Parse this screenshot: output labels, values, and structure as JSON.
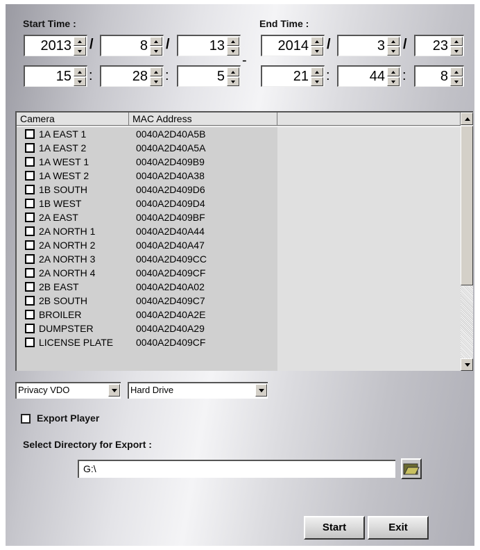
{
  "start_time": {
    "label": "Start Time :",
    "year": "2013",
    "month": "8",
    "day": "13",
    "hour": "15",
    "minute": "28",
    "second": "5"
  },
  "end_time": {
    "label": "End Time :",
    "year": "2014",
    "month": "3",
    "day": "23",
    "hour": "21",
    "minute": "44",
    "second": "8"
  },
  "separators": {
    "date": "/",
    "time": ":",
    "range": "-"
  },
  "camera_list": {
    "columns": [
      "Camera",
      "MAC Address"
    ],
    "rows": [
      {
        "camera": "1A EAST 1",
        "mac": "0040A2D40A5B"
      },
      {
        "camera": "1A EAST 2",
        "mac": "0040A2D40A5A"
      },
      {
        "camera": "1A WEST 1",
        "mac": "0040A2D409B9"
      },
      {
        "camera": "1A WEST 2",
        "mac": "0040A2D40A38"
      },
      {
        "camera": "1B SOUTH",
        "mac": "0040A2D409D6"
      },
      {
        "camera": "1B WEST",
        "mac": "0040A2D409D4"
      },
      {
        "camera": "2A EAST",
        "mac": "0040A2D409BF"
      },
      {
        "camera": "2A NORTH 1",
        "mac": "0040A2D40A44"
      },
      {
        "camera": "2A NORTH 2",
        "mac": "0040A2D40A47"
      },
      {
        "camera": "2A NORTH 3",
        "mac": "0040A2D409CC"
      },
      {
        "camera": "2A NORTH 4",
        "mac": "0040A2D409CF"
      },
      {
        "camera": "2B EAST",
        "mac": "0040A2D40A02"
      },
      {
        "camera": "2B SOUTH",
        "mac": "0040A2D409C7"
      },
      {
        "camera": "BROILER",
        "mac": "0040A2D40A2E"
      },
      {
        "camera": "DUMPSTER",
        "mac": "0040A2D40A29"
      },
      {
        "camera": "LICENSE PLATE",
        "mac": "0040A2D409CF"
      }
    ]
  },
  "format_select": {
    "value": "Privacy VDO"
  },
  "destination_select": {
    "value": "Hard Drive"
  },
  "export_player": {
    "label": "Export Player",
    "checked": false
  },
  "directory": {
    "label": "Select Directory for Export :",
    "value": "G:\\"
  },
  "icons": {
    "browse": "folder-browse-icon"
  },
  "buttons": {
    "start": "Start",
    "exit": "Exit"
  }
}
